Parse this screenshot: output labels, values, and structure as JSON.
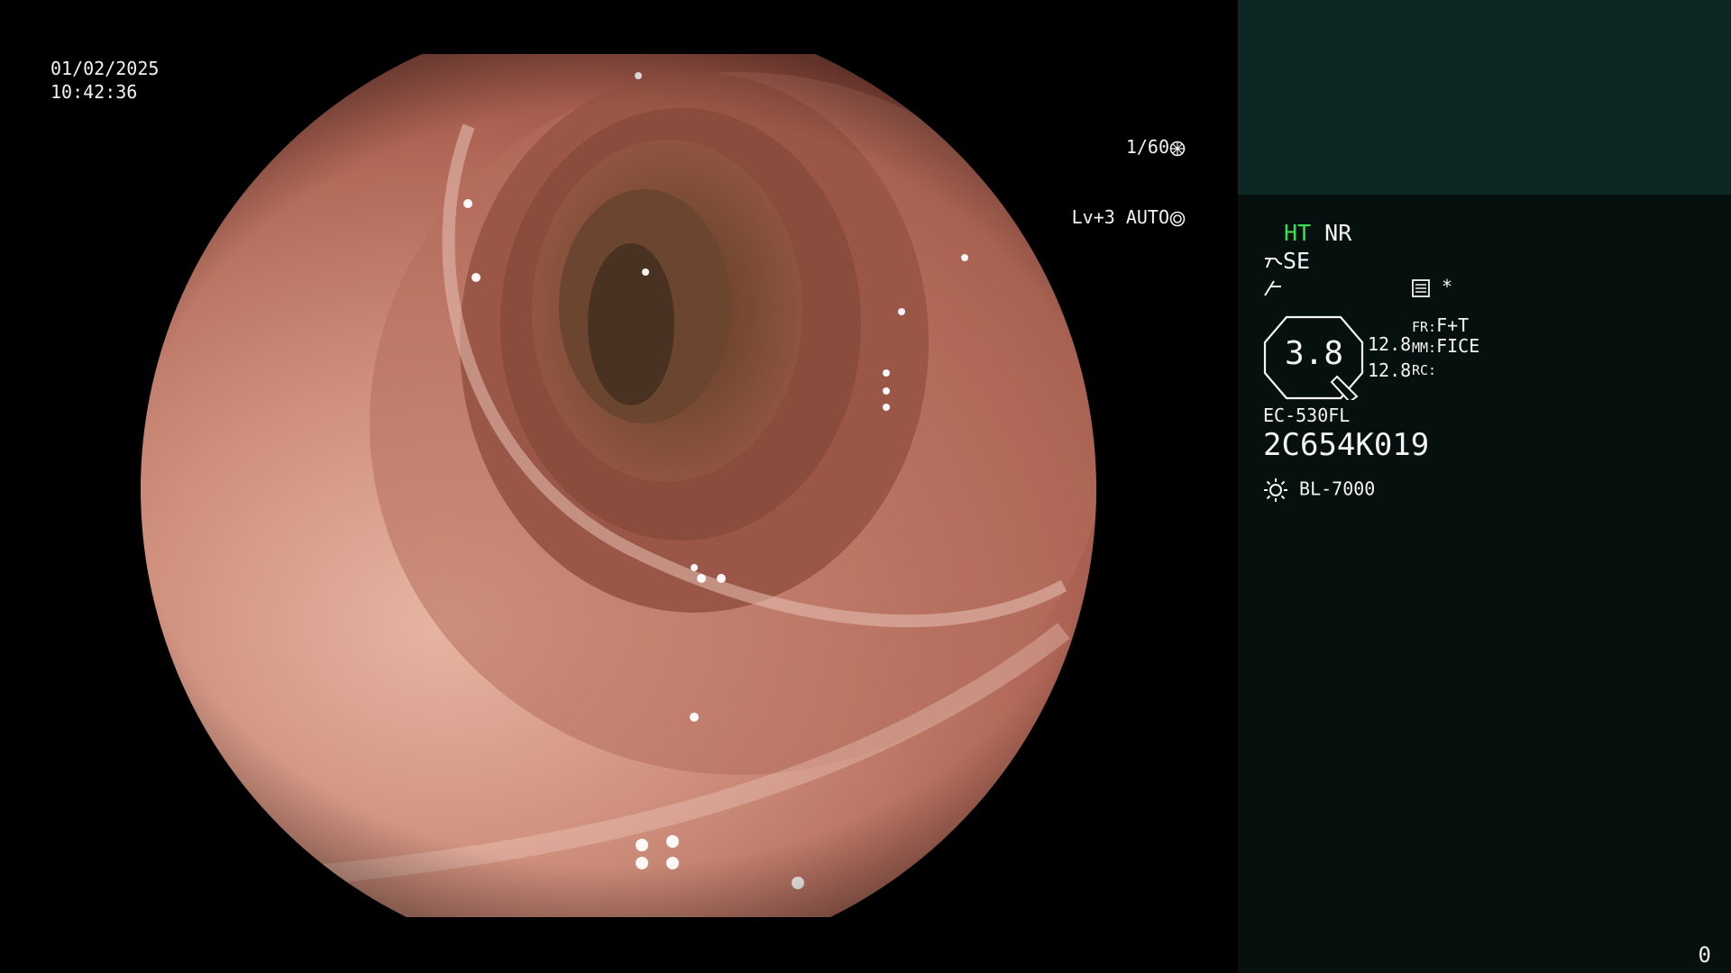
{
  "overlay": {
    "date": "01/02/2025",
    "time": "10:42:36",
    "shutter": "1/60",
    "level": "Lv+3",
    "iris_mode": "AUTO"
  },
  "sidebar": {
    "ht": "HT",
    "nr": "NR",
    "se": "SE",
    "zoom_value": "3.8",
    "val_top": "12.8",
    "val_bottom": "12.8",
    "fr_label": "FR:",
    "fr_value": "F+T",
    "mm_label": "MM:",
    "mm_value": "FICE",
    "rc_label": "RC:",
    "scope_model": "EC-530FL",
    "scope_serial": "2C654K019",
    "light_source": "BL-7000",
    "asterisk": "*"
  },
  "counter": "0",
  "colors": {
    "ht_accent": "#39e04d",
    "panel_top": "#0d2724",
    "panel_bottom": "#06110f"
  },
  "icons": [
    "shutter-icon",
    "iris-icon",
    "structure-enhance-icon",
    "color-enhance-icon",
    "memo-icon",
    "light-source-icon"
  ]
}
